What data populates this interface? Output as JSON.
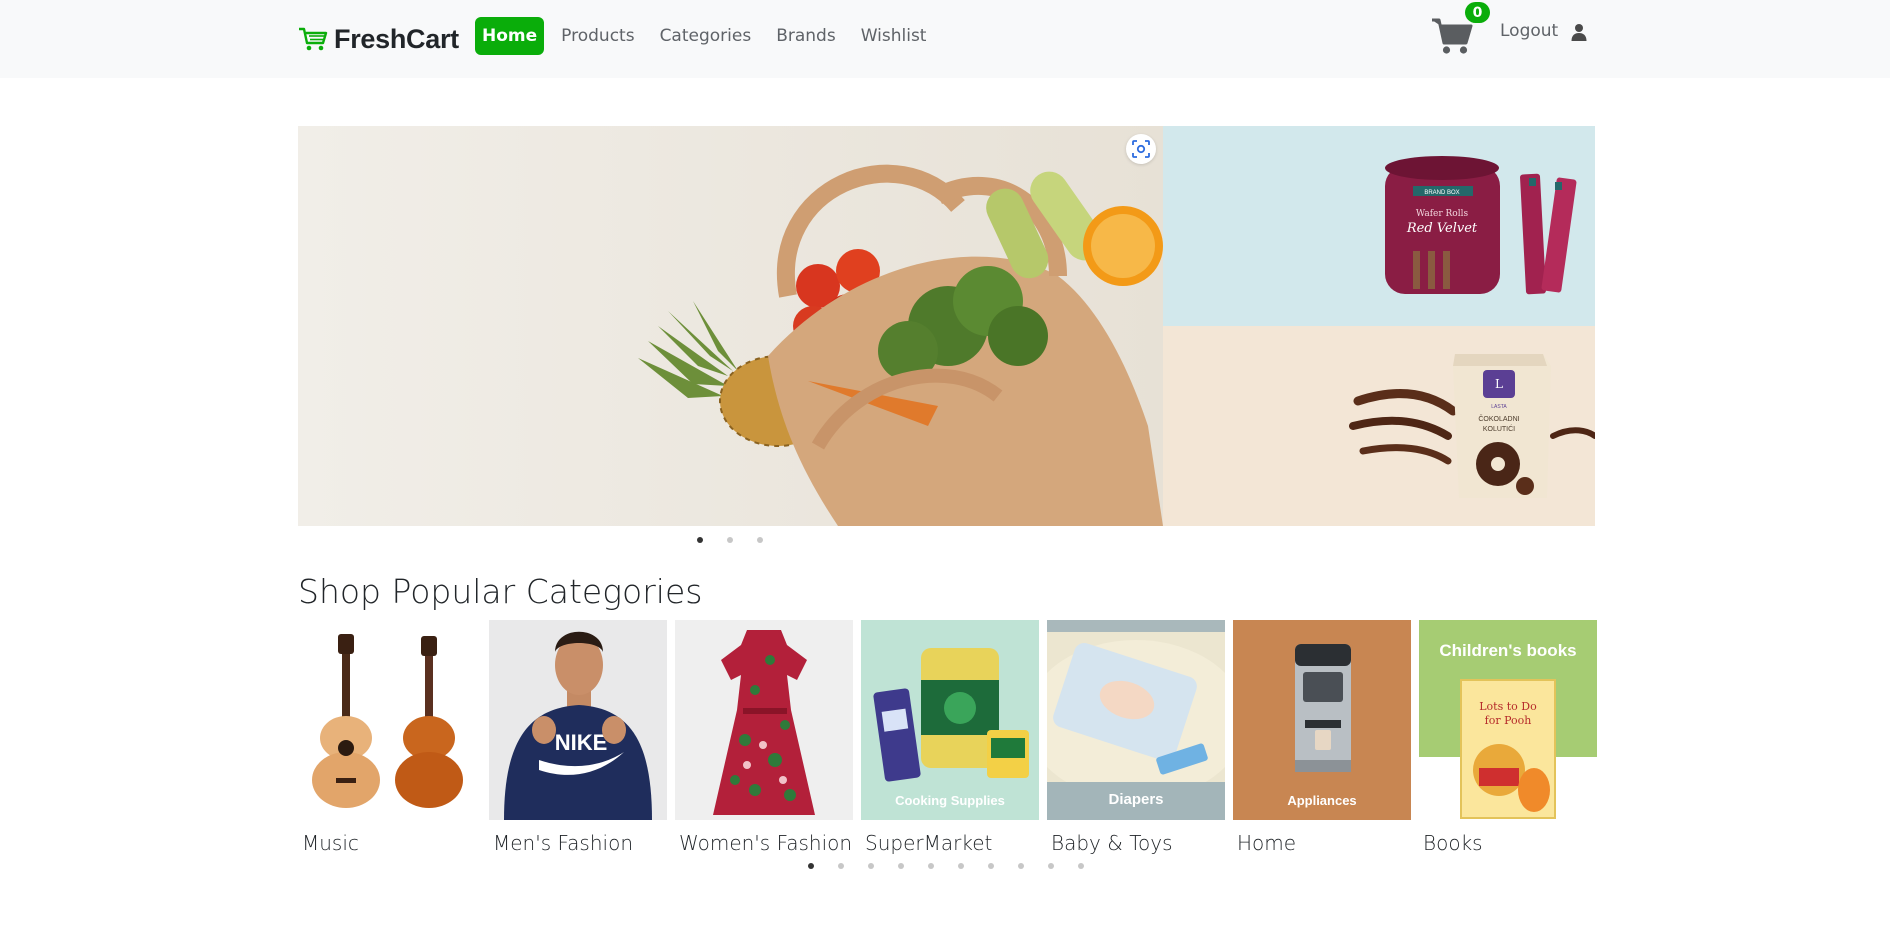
{
  "brand": {
    "name": "FreshCart",
    "icon": "shopping-cart-icon",
    "color": "#0aad0a"
  },
  "nav": {
    "links": [
      {
        "label": "Home",
        "active": true
      },
      {
        "label": "Products",
        "active": false
      },
      {
        "label": "Categories",
        "active": false
      },
      {
        "label": "Brands",
        "active": false
      },
      {
        "label": "Wishlist",
        "active": false
      }
    ],
    "cart_count": "0",
    "logout_label": "Logout"
  },
  "hero": {
    "slide_count": 3,
    "active_slide": 0,
    "side_top_product": {
      "brand": "BRAND BOX",
      "line1": "Wafer Rolls",
      "line2": "Red Velvet"
    },
    "side_bottom_product": {
      "brand": "LASTA",
      "line1": "ČOKOLADNI",
      "line2": "KOLUTIĆI"
    }
  },
  "categories": {
    "title": "Shop Popular Categories",
    "items": [
      {
        "name": "Music",
        "overlay": ""
      },
      {
        "name": "Men's Fashion",
        "overlay": ""
      },
      {
        "name": "Women's Fashion",
        "overlay": ""
      },
      {
        "name": "SuperMarket",
        "overlay": "Cooking Supplies"
      },
      {
        "name": "Baby & Toys",
        "overlay": "Diapers"
      },
      {
        "name": "Home",
        "overlay": "Appliances"
      },
      {
        "name": "Books",
        "overlay": "Children's books",
        "book_title": "Lots to Do for Pooh"
      }
    ],
    "page_count": 10,
    "active_page": 0
  },
  "colors": {
    "accent": "#0aad0a",
    "navbar_bg": "#f8f9fa"
  }
}
